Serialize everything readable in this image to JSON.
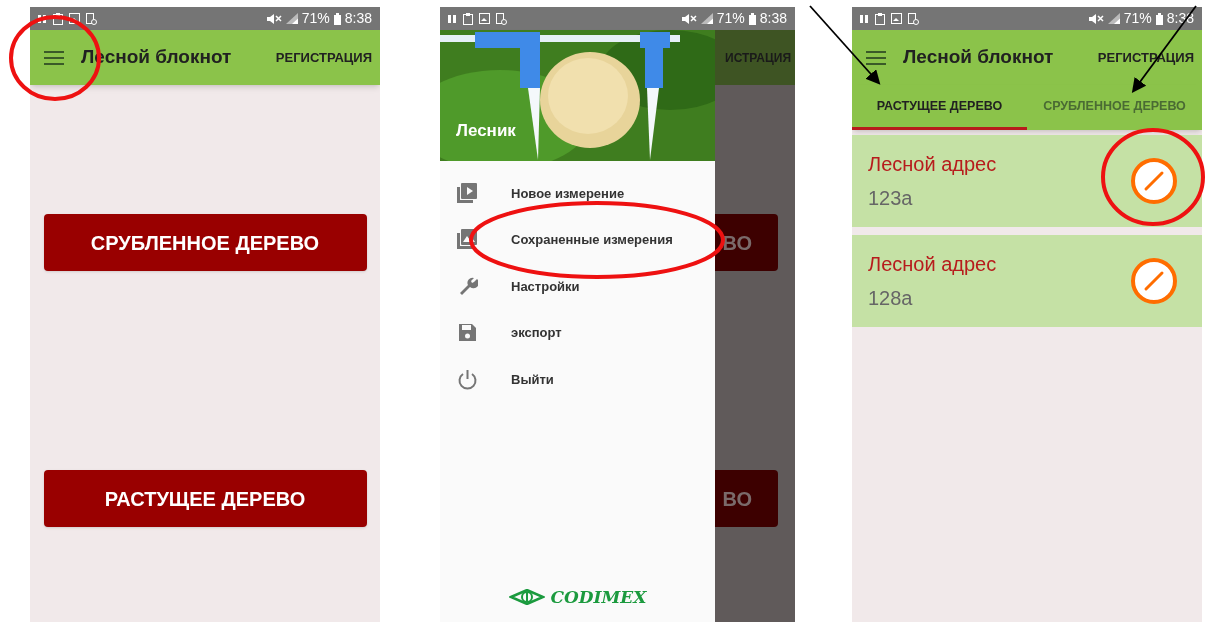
{
  "screens": [
    {
      "kind": "home",
      "status_bar": {
        "battery": "71%",
        "time": "8:38"
      },
      "app_bar": {
        "title": "Лесной блокнот",
        "action": "РЕГИСТРАЦИЯ"
      },
      "buttons": [
        "СРУБЛЕННОЕ ДЕРЕВО",
        "РАСТУЩЕЕ ДЕРЕВО"
      ]
    },
    {
      "kind": "drawer",
      "status_bar": {
        "battery": "71%",
        "time": "8:38"
      },
      "drawer": {
        "header": "Лесник",
        "items": [
          "Новое измерение",
          "Сохраненные измерения",
          "Настройки",
          "экспорт",
          "Выйти"
        ],
        "logo": "CODIMEX"
      },
      "behind": {
        "action": "ИСТРАЦИЯ",
        "buttons": [
          "ВО",
          "ВО"
        ]
      }
    },
    {
      "kind": "list",
      "status_bar": {
        "battery": "71%",
        "time": "8:38"
      },
      "app_bar": {
        "title": "Лесной блокнот",
        "action": "РЕГИСТРАЦИЯ"
      },
      "tabs": [
        {
          "label": "РАСТУЩЕЕ ДЕРЕВО",
          "selected": true
        },
        {
          "label": "СРУБЛЕННОЕ ДЕРЕВО",
          "selected": false
        }
      ],
      "rows": [
        {
          "title": "Лесной адрес",
          "subtitle": "123а"
        },
        {
          "title": "Лесной адрес",
          "subtitle": "128а"
        }
      ]
    }
  ],
  "annotations": [
    {
      "kind": "circle"
    },
    {
      "kind": "circle"
    },
    {
      "kind": "arrow"
    },
    {
      "kind": "arrow"
    },
    {
      "kind": "circle"
    }
  ]
}
